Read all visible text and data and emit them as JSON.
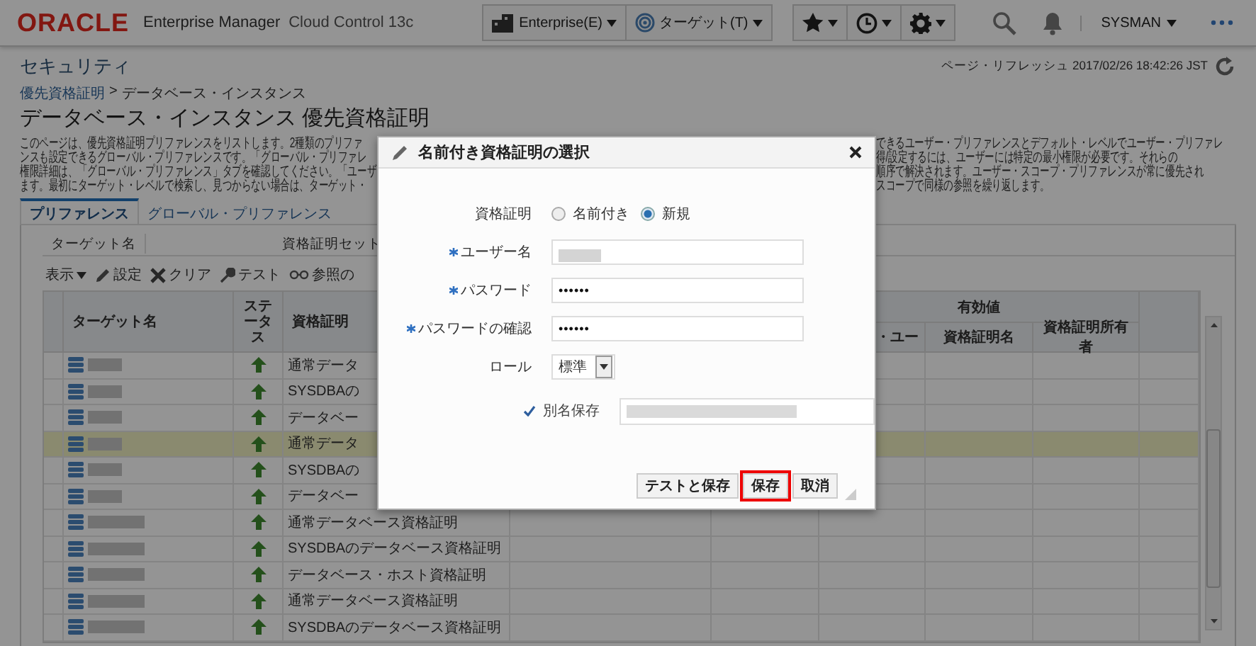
{
  "header": {
    "logo": "ORACLE",
    "product": "Enterprise Manager",
    "edition": "Cloud Control 13c",
    "menus": [
      {
        "label": "Enterprise(E)"
      },
      {
        "label": "ターゲット(T)"
      }
    ],
    "user": "SYSMAN"
  },
  "page": {
    "section": "セキュリティ",
    "refresh": "ページ・リフレッシュ 2017/02/26 18:42:26 JST",
    "breadcrumb": [
      {
        "label": "優先資格証明",
        "link": true
      },
      {
        "label": "データベース・インスタンス",
        "link": false
      }
    ],
    "breadcrumb_separator": ">",
    "title": "データベース・インスタンス 優先資格証明"
  },
  "description": {
    "left_lines": [
      "このページは、優先資格証明プリファレンスをリストします。2種類のプリファ",
      "ンスも設定できるグローバル・プリファレンスです。「グローバル・プリファレ",
      "権限詳細は、「グローバル・プリファレンス」タブを確認してください。「ユーザ",
      "ます。最初にターゲット・レベルで検索し、見つからない場合は、ターゲット・"
    ],
    "right_lines": [
      "できるユーザー・プリファレンスとデフォルト・レベルでユーザー・プリファレ",
      "得/設定するには、ユーザーには特定の最小権限が必要です。それらの",
      "順序で解決されます。ユーザー・スコープ・プリファレンスが常に優先され",
      "スコープで同様の参照を繰り返します。"
    ]
  },
  "tabs": [
    {
      "label": "プリファレンス",
      "selected": true
    },
    {
      "label": "グローバル・プリファレンス",
      "selected": false
    }
  ],
  "search": [
    {
      "label": "ターゲット名"
    },
    {
      "label": "資格証明セット"
    }
  ],
  "toolbar": [
    {
      "label": "表示",
      "kind": "menu"
    },
    {
      "label": "設定",
      "kind": "edit"
    },
    {
      "label": "クリア",
      "kind": "clear"
    },
    {
      "label": "テスト",
      "kind": "test"
    },
    {
      "label": "参照の",
      "kind": "view"
    }
  ],
  "table": {
    "columns": {
      "target": "ターゲット名",
      "status": "ステータス",
      "credential_set": "資格証明",
      "column_6": "・ユー",
      "group": "有効値",
      "credential_name": "資格証明名",
      "credential_owner": "資格証明所有者"
    },
    "rows": [
      {
        "credential_set": "通常データ",
        "online": true,
        "selected": false
      },
      {
        "credential_set": "SYSDBAの",
        "online": true,
        "selected": false
      },
      {
        "credential_set": "データベー",
        "online": true,
        "selected": false
      },
      {
        "credential_set": "通常データ",
        "online": true,
        "selected": true
      },
      {
        "credential_set": "SYSDBAの",
        "online": true,
        "selected": false
      },
      {
        "credential_set": "データベー",
        "online": true,
        "selected": false
      },
      {
        "credential_set": "通常データベース資格証明",
        "online": true,
        "selected": false
      },
      {
        "credential_set": "SYSDBAのデータベース資格証明",
        "online": true,
        "selected": false
      },
      {
        "credential_set": "データベース・ホスト資格証明",
        "online": true,
        "selected": false
      },
      {
        "credential_set": "通常データベース資格証明",
        "online": true,
        "selected": false
      },
      {
        "credential_set": "SYSDBAのデータベース資格証明",
        "online": true,
        "selected": false
      }
    ]
  },
  "dialog": {
    "title": "名前付き資格証明の選択",
    "credential": {
      "label": "資格証明",
      "options": [
        {
          "label": "名前付き",
          "selected": false
        },
        {
          "label": "新規",
          "selected": true
        }
      ]
    },
    "fields": [
      {
        "label": "ユーザー名",
        "required": true,
        "kind": "redacted"
      },
      {
        "label": "パスワード",
        "required": true,
        "kind": "password",
        "value": "••••••"
      },
      {
        "label": "パスワードの確認",
        "required": true,
        "kind": "password",
        "value": "••••••"
      },
      {
        "label": "ロール",
        "required": false,
        "kind": "select",
        "value": "標準"
      }
    ],
    "save_as": {
      "label": "別名保存",
      "checked": true
    },
    "buttons": [
      {
        "label": "テストと保存",
        "focused": false
      },
      {
        "label": "保存",
        "focused": true
      },
      {
        "label": "取消",
        "focused": false
      }
    ]
  }
}
